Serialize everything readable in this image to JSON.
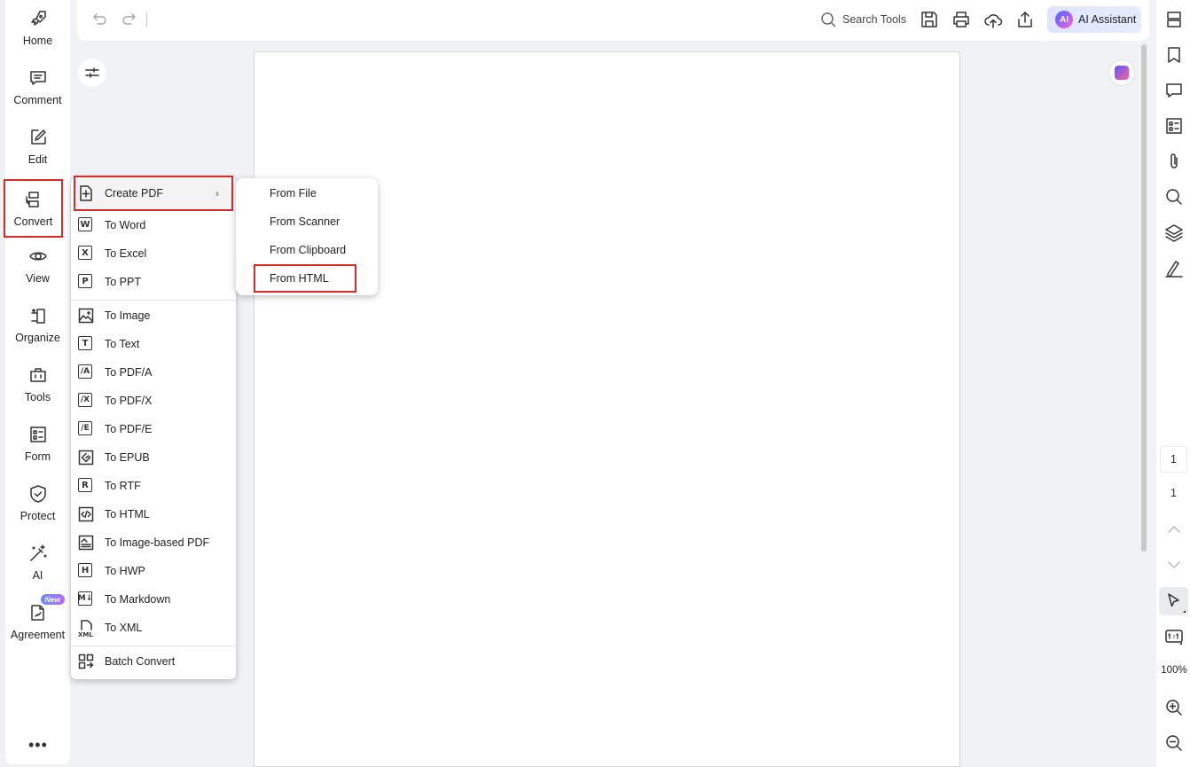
{
  "left_nav": {
    "items": [
      {
        "label": "Home",
        "icon": "rocket-icon"
      },
      {
        "label": "Comment",
        "icon": "comment-icon"
      },
      {
        "label": "Edit",
        "icon": "edit-icon"
      },
      {
        "label": "Convert",
        "icon": "convert-icon",
        "selected": true
      },
      {
        "label": "View",
        "icon": "eye-icon"
      },
      {
        "label": "Organize",
        "icon": "organize-icon"
      },
      {
        "label": "Tools",
        "icon": "toolbox-icon"
      },
      {
        "label": "Form",
        "icon": "form-icon"
      },
      {
        "label": "Protect",
        "icon": "shield-icon"
      },
      {
        "label": "AI",
        "icon": "magic-wand-icon"
      },
      {
        "label": "Agreement",
        "icon": "agreement-icon",
        "badge": "New"
      }
    ],
    "more": "•••"
  },
  "toolbar": {
    "search_placeholder": "Search Tools",
    "ai_button_label": "AI Assistant",
    "ai_logo_text": "AI"
  },
  "convert_menu": {
    "create_pdf": "Create PDF",
    "groups": [
      [
        {
          "label": "To Word",
          "glyph": "W"
        },
        {
          "label": "To Excel",
          "glyph": "X"
        },
        {
          "label": "To PPT",
          "glyph": "P"
        }
      ],
      [
        {
          "label": "To Image",
          "glyph": "image"
        },
        {
          "label": "To Text",
          "glyph": "T"
        },
        {
          "label": "To PDF/A",
          "glyph": "/A"
        },
        {
          "label": "To PDF/X",
          "glyph": "/X"
        },
        {
          "label": "To PDF/E",
          "glyph": "/E"
        },
        {
          "label": "To EPUB",
          "glyph": "epub"
        },
        {
          "label": "To RTF",
          "glyph": "R"
        },
        {
          "label": "To HTML",
          "glyph": "</>"
        },
        {
          "label": "To Image-based PDF",
          "glyph": "imgpdf"
        },
        {
          "label": "To HWP",
          "glyph": "H"
        },
        {
          "label": "To Markdown",
          "glyph": "M↓"
        },
        {
          "label": "To XML",
          "glyph": "XML"
        }
      ]
    ],
    "batch_convert": "Batch Convert"
  },
  "create_pdf_submenu": {
    "items": [
      "From File",
      "From Scanner",
      "From Clipboard",
      "From HTML"
    ],
    "highlighted": "From HTML"
  },
  "page_nav": {
    "current_page": "1",
    "total_pages": "1",
    "zoom": "100%"
  },
  "colors": {
    "highlight_border": "#d92a2a",
    "ai_gradient_start": "#4e6bff",
    "ai_gradient_end": "#ff6ac1"
  }
}
